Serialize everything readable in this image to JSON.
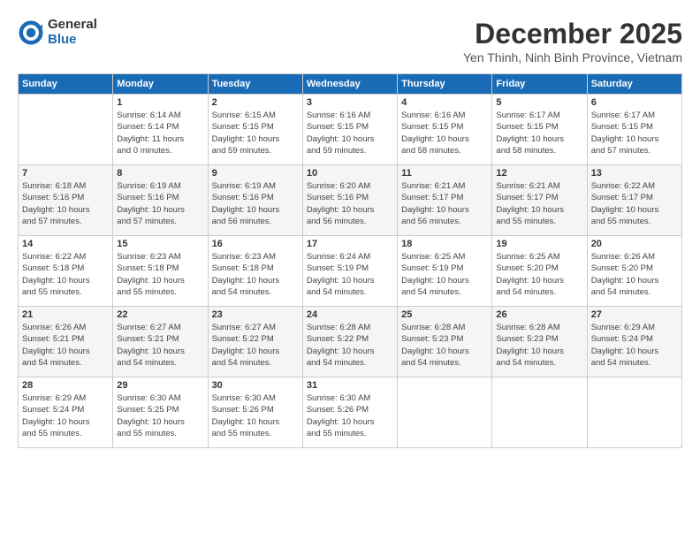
{
  "header": {
    "logo": {
      "general": "General",
      "blue": "Blue"
    },
    "title": "December 2025",
    "location": "Yen Thinh, Ninh Binh Province, Vietnam"
  },
  "calendar": {
    "weekdays": [
      "Sunday",
      "Monday",
      "Tuesday",
      "Wednesday",
      "Thursday",
      "Friday",
      "Saturday"
    ],
    "weeks": [
      [
        {
          "day": "",
          "info": ""
        },
        {
          "day": "1",
          "info": "Sunrise: 6:14 AM\nSunset: 5:14 PM\nDaylight: 11 hours\nand 0 minutes."
        },
        {
          "day": "2",
          "info": "Sunrise: 6:15 AM\nSunset: 5:15 PM\nDaylight: 10 hours\nand 59 minutes."
        },
        {
          "day": "3",
          "info": "Sunrise: 6:16 AM\nSunset: 5:15 PM\nDaylight: 10 hours\nand 59 minutes."
        },
        {
          "day": "4",
          "info": "Sunrise: 6:16 AM\nSunset: 5:15 PM\nDaylight: 10 hours\nand 58 minutes."
        },
        {
          "day": "5",
          "info": "Sunrise: 6:17 AM\nSunset: 5:15 PM\nDaylight: 10 hours\nand 58 minutes."
        },
        {
          "day": "6",
          "info": "Sunrise: 6:17 AM\nSunset: 5:15 PM\nDaylight: 10 hours\nand 57 minutes."
        }
      ],
      [
        {
          "day": "7",
          "info": "Sunrise: 6:18 AM\nSunset: 5:16 PM\nDaylight: 10 hours\nand 57 minutes."
        },
        {
          "day": "8",
          "info": "Sunrise: 6:19 AM\nSunset: 5:16 PM\nDaylight: 10 hours\nand 57 minutes."
        },
        {
          "day": "9",
          "info": "Sunrise: 6:19 AM\nSunset: 5:16 PM\nDaylight: 10 hours\nand 56 minutes."
        },
        {
          "day": "10",
          "info": "Sunrise: 6:20 AM\nSunset: 5:16 PM\nDaylight: 10 hours\nand 56 minutes."
        },
        {
          "day": "11",
          "info": "Sunrise: 6:21 AM\nSunset: 5:17 PM\nDaylight: 10 hours\nand 56 minutes."
        },
        {
          "day": "12",
          "info": "Sunrise: 6:21 AM\nSunset: 5:17 PM\nDaylight: 10 hours\nand 55 minutes."
        },
        {
          "day": "13",
          "info": "Sunrise: 6:22 AM\nSunset: 5:17 PM\nDaylight: 10 hours\nand 55 minutes."
        }
      ],
      [
        {
          "day": "14",
          "info": "Sunrise: 6:22 AM\nSunset: 5:18 PM\nDaylight: 10 hours\nand 55 minutes."
        },
        {
          "day": "15",
          "info": "Sunrise: 6:23 AM\nSunset: 5:18 PM\nDaylight: 10 hours\nand 55 minutes."
        },
        {
          "day": "16",
          "info": "Sunrise: 6:23 AM\nSunset: 5:18 PM\nDaylight: 10 hours\nand 54 minutes."
        },
        {
          "day": "17",
          "info": "Sunrise: 6:24 AM\nSunset: 5:19 PM\nDaylight: 10 hours\nand 54 minutes."
        },
        {
          "day": "18",
          "info": "Sunrise: 6:25 AM\nSunset: 5:19 PM\nDaylight: 10 hours\nand 54 minutes."
        },
        {
          "day": "19",
          "info": "Sunrise: 6:25 AM\nSunset: 5:20 PM\nDaylight: 10 hours\nand 54 minutes."
        },
        {
          "day": "20",
          "info": "Sunrise: 6:26 AM\nSunset: 5:20 PM\nDaylight: 10 hours\nand 54 minutes."
        }
      ],
      [
        {
          "day": "21",
          "info": "Sunrise: 6:26 AM\nSunset: 5:21 PM\nDaylight: 10 hours\nand 54 minutes."
        },
        {
          "day": "22",
          "info": "Sunrise: 6:27 AM\nSunset: 5:21 PM\nDaylight: 10 hours\nand 54 minutes."
        },
        {
          "day": "23",
          "info": "Sunrise: 6:27 AM\nSunset: 5:22 PM\nDaylight: 10 hours\nand 54 minutes."
        },
        {
          "day": "24",
          "info": "Sunrise: 6:28 AM\nSunset: 5:22 PM\nDaylight: 10 hours\nand 54 minutes."
        },
        {
          "day": "25",
          "info": "Sunrise: 6:28 AM\nSunset: 5:23 PM\nDaylight: 10 hours\nand 54 minutes."
        },
        {
          "day": "26",
          "info": "Sunrise: 6:28 AM\nSunset: 5:23 PM\nDaylight: 10 hours\nand 54 minutes."
        },
        {
          "day": "27",
          "info": "Sunrise: 6:29 AM\nSunset: 5:24 PM\nDaylight: 10 hours\nand 54 minutes."
        }
      ],
      [
        {
          "day": "28",
          "info": "Sunrise: 6:29 AM\nSunset: 5:24 PM\nDaylight: 10 hours\nand 55 minutes."
        },
        {
          "day": "29",
          "info": "Sunrise: 6:30 AM\nSunset: 5:25 PM\nDaylight: 10 hours\nand 55 minutes."
        },
        {
          "day": "30",
          "info": "Sunrise: 6:30 AM\nSunset: 5:26 PM\nDaylight: 10 hours\nand 55 minutes."
        },
        {
          "day": "31",
          "info": "Sunrise: 6:30 AM\nSunset: 5:26 PM\nDaylight: 10 hours\nand 55 minutes."
        },
        {
          "day": "",
          "info": ""
        },
        {
          "day": "",
          "info": ""
        },
        {
          "day": "",
          "info": ""
        }
      ]
    ]
  }
}
